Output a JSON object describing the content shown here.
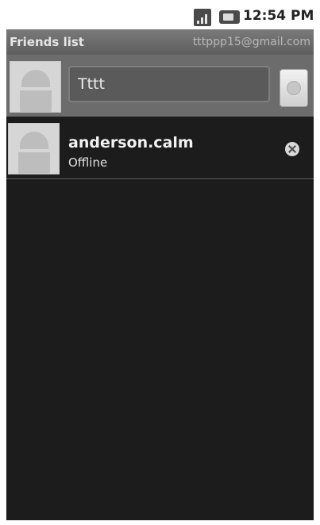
{
  "status_bar": {
    "time": "12:54 PM",
    "signal_icon": "signal-icon",
    "battery_icon": "battery-icon"
  },
  "title_bar": {
    "title": "Friends list",
    "account": "tttppp15@gmail.com"
  },
  "self": {
    "avatar_icon": "android-robot-icon",
    "status_value": "Tttt",
    "set_button_icon": "presence-circle-icon"
  },
  "friends": [
    {
      "name": "anderson.calm",
      "status": "Offline",
      "avatar_icon": "android-robot-icon",
      "presence_icon": "offline-icon"
    }
  ]
}
